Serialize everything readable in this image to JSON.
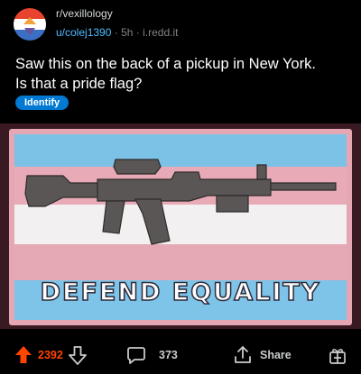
{
  "post": {
    "subreddit": "r/vexillology",
    "author": "u/colej1390",
    "separator": "·",
    "age": "5h",
    "domain": "i.redd.it",
    "title_line1": "Saw this on the back of a pickup in New York.",
    "title_line2": "Is that a pride flag?",
    "flair": "Identify",
    "image_caption": "DEFEND EQUALITY"
  },
  "actions": {
    "upvote_count": "2392",
    "comment_count": "373",
    "share_label": "Share"
  },
  "colors": {
    "background": "#000000",
    "upvote_active": "#ff4500",
    "username": "#4fbcff",
    "flair_bg": "#0079d3",
    "trans_blue": "#5bcefa",
    "trans_pink": "#f5a9b8"
  },
  "icons": {
    "upvote": "upvote-arrow-icon",
    "downvote": "downvote-arrow-icon",
    "comments": "comment-bubble-icon",
    "share": "share-icon",
    "award": "award-icon"
  }
}
